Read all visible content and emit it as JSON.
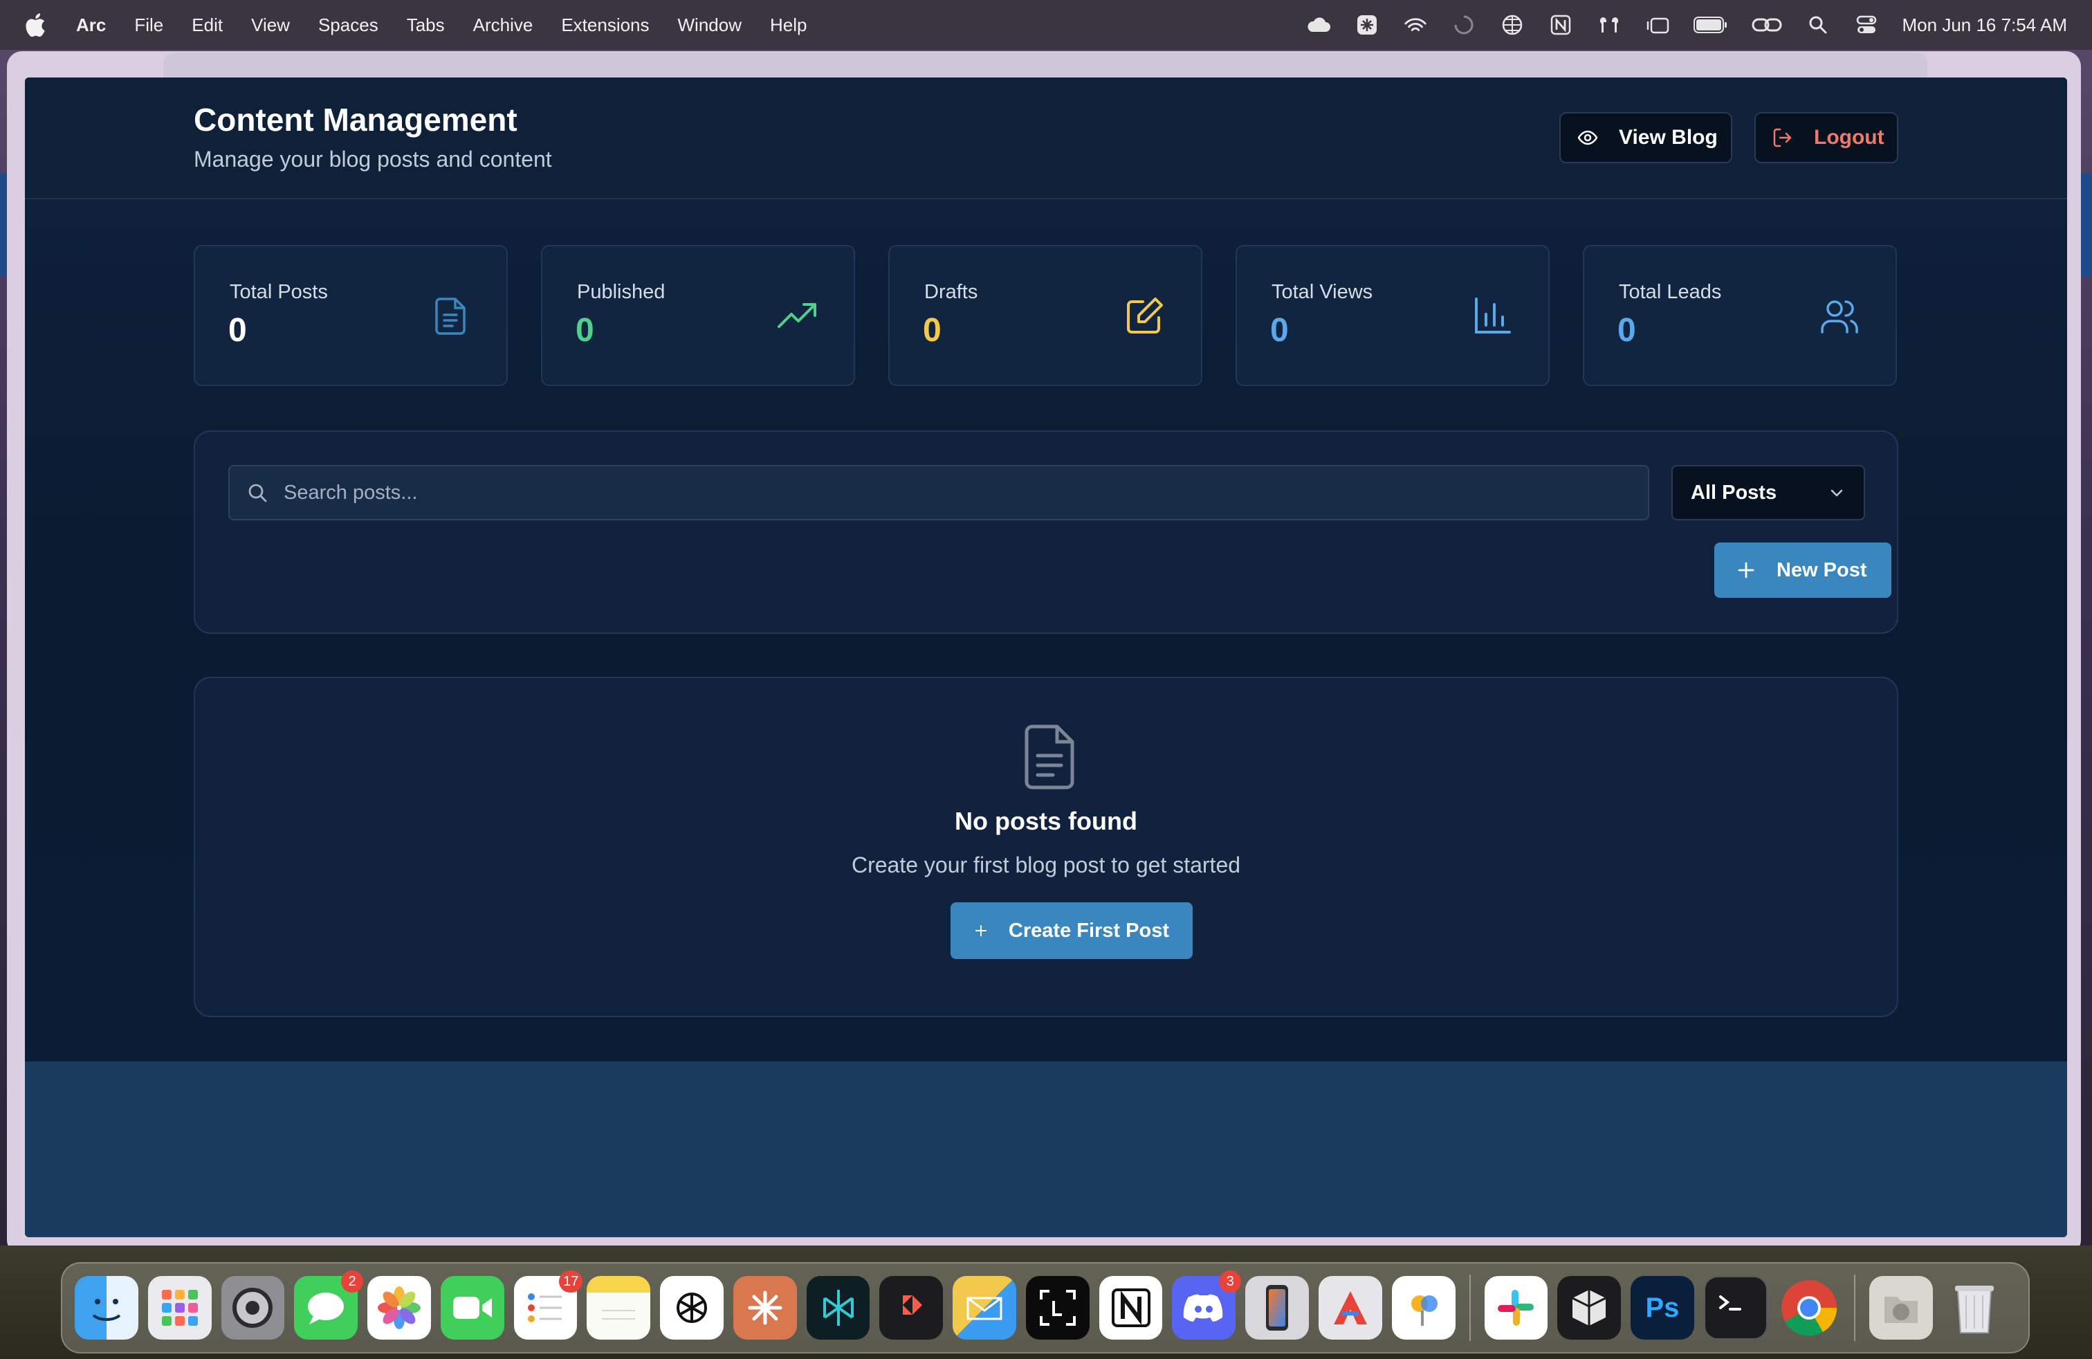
{
  "menubar": {
    "app_name": "Arc",
    "items": [
      "File",
      "Edit",
      "View",
      "Spaces",
      "Tabs",
      "Archive",
      "Extensions",
      "Window",
      "Help"
    ],
    "clock": "Mon Jun 16  7:54 AM"
  },
  "header": {
    "title": "Content Management",
    "subtitle": "Manage your blog posts and content",
    "view_blog_label": "View Blog",
    "logout_label": "Logout"
  },
  "stats": [
    {
      "label": "Total Posts",
      "value": "0",
      "color": "#ffffff",
      "icon": "document-icon",
      "icon_color": "#3a86bf"
    },
    {
      "label": "Published",
      "value": "0",
      "color": "#4fd18b",
      "icon": "trending-up-icon",
      "icon_color": "#4fd18b"
    },
    {
      "label": "Drafts",
      "value": "0",
      "color": "#f2c94c",
      "icon": "edit-icon",
      "icon_color": "#f2c94c"
    },
    {
      "label": "Total Views",
      "value": "0",
      "color": "#5aa9ea",
      "icon": "bar-chart-icon",
      "icon_color": "#5aa9ea"
    },
    {
      "label": "Total Leads",
      "value": "0",
      "color": "#5aa9ea",
      "icon": "users-icon",
      "icon_color": "#5aa9ea"
    }
  ],
  "filters": {
    "search_placeholder": "Search posts...",
    "search_value": "",
    "status_selected": "All Posts",
    "new_post_label": "New Post"
  },
  "empty_state": {
    "title": "No posts found",
    "description": "Create your first blog post to get started",
    "button_label": "Create First Post"
  },
  "dock": {
    "apps": [
      {
        "name": "finder",
        "badge": ""
      },
      {
        "name": "launchpad",
        "badge": ""
      },
      {
        "name": "system-settings",
        "badge": ""
      },
      {
        "name": "messages",
        "badge": "2"
      },
      {
        "name": "photos",
        "badge": ""
      },
      {
        "name": "facetime",
        "badge": ""
      },
      {
        "name": "reminders",
        "badge": "17"
      },
      {
        "name": "notes",
        "badge": ""
      },
      {
        "name": "chatgpt",
        "badge": ""
      },
      {
        "name": "claude",
        "badge": ""
      },
      {
        "name": "perplexity",
        "badge": ""
      },
      {
        "name": "raycast",
        "badge": ""
      },
      {
        "name": "airmail",
        "badge": ""
      },
      {
        "name": "screen-capture",
        "badge": ""
      },
      {
        "name": "notion",
        "badge": ""
      },
      {
        "name": "discord",
        "badge": "3"
      },
      {
        "name": "iphone-mirroring",
        "badge": ""
      },
      {
        "name": "pixelmator",
        "badge": ""
      },
      {
        "name": "maps",
        "badge": ""
      },
      {
        "name": "slack",
        "badge": ""
      },
      {
        "name": "cube-app",
        "badge": ""
      },
      {
        "name": "photoshop",
        "badge": ""
      },
      {
        "name": "terminal",
        "badge": ""
      },
      {
        "name": "chrome",
        "badge": ""
      },
      {
        "name": "downloads-folder",
        "badge": ""
      },
      {
        "name": "trash",
        "badge": ""
      }
    ]
  }
}
